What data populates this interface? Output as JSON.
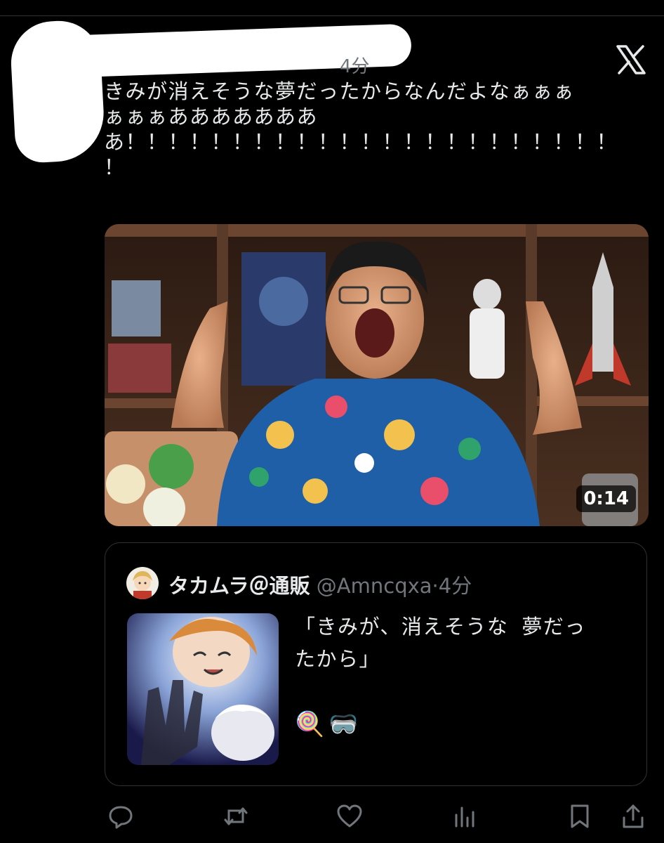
{
  "tweet": {
    "timestamp_peek": "4分",
    "text": "きみが消えそうな夢だったからなんだよなぁぁぁ\nぁぁぁあああああああ\nあ！！！！！！！！！！！！！！！！！！！！！！！\n！"
  },
  "video": {
    "duration": "0:14"
  },
  "quote": {
    "name": "タカムラ＠通販",
    "handle": "@Amncqxa",
    "separator": "·",
    "time": "4分",
    "text": "「きみが、消えそうな 夢だっ\nたから」",
    "emojis": [
      "🍭",
      "🥽"
    ]
  },
  "actions": {
    "reply": "reply-icon",
    "retweet": "retweet-icon",
    "like": "heart-icon",
    "views": "views-icon",
    "bookmark": "bookmark-icon",
    "share": "share-icon"
  },
  "colors": {
    "background": "#000000",
    "text": "#e7e9ea",
    "secondary": "#71767b",
    "border": "#2f3336"
  }
}
